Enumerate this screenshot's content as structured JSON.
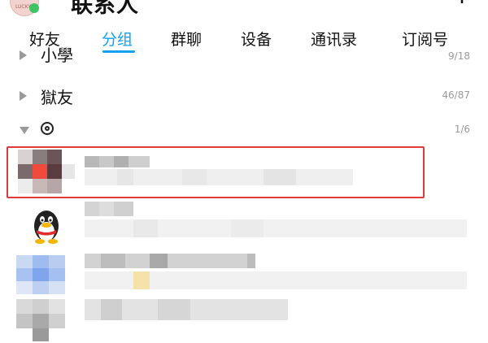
{
  "header": {
    "title": "联系人",
    "avatar_badge_text": "LUCKY",
    "add_icon": "add-contact-icon"
  },
  "tabs": [
    {
      "label": "好友"
    },
    {
      "label": "分组",
      "active": true
    },
    {
      "label": "群聊"
    },
    {
      "label": "设备"
    },
    {
      "label": "通讯录"
    },
    {
      "label": "订阅号"
    }
  ],
  "groups": [
    {
      "name": "小學",
      "count": "9/18",
      "expanded": false
    },
    {
      "name": "獄友",
      "count": "46/87",
      "expanded": false
    },
    {
      "name": "",
      "icon": "ring-icon",
      "count": "1/6",
      "expanded": true
    }
  ],
  "contacts": [
    {
      "avatar": "pixelated-avatar",
      "highlighted": true
    },
    {
      "avatar": "penguin-avatar",
      "highlighted": false
    },
    {
      "avatar": "pixelated-avatar",
      "highlighted": false
    },
    {
      "avatar": "pixelated-avatar",
      "highlighted": false
    }
  ],
  "colors": {
    "accent": "#12a0f0",
    "highlight_border": "#e03a3a",
    "status_online": "#3cc463",
    "muted_text": "#9a9a9a"
  }
}
